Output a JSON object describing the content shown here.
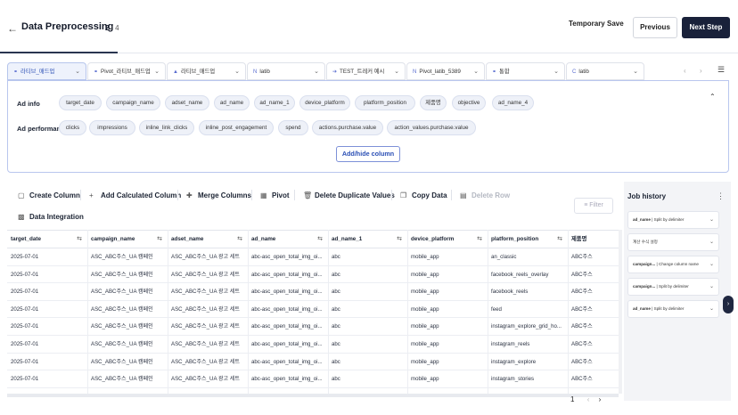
{
  "header": {
    "back_icon": "arrow-left-icon",
    "title": "Data Preprocessing",
    "step_current": "2",
    "step_total": " / 4",
    "progress_fraction": 0.4,
    "temporary_save": "Temporary Save",
    "previous": "Previous",
    "next": "Next Step"
  },
  "tabs": [
    {
      "icon": "link-icon",
      "label": "라티브_매드업",
      "active": true
    },
    {
      "icon": "link-icon",
      "label": "Pivot_라티브_매드업",
      "active": false
    },
    {
      "icon": "triangle-icon",
      "label": "라티브_매드업",
      "active": false
    },
    {
      "icon": "n-icon",
      "label": "latib",
      "active": false
    },
    {
      "icon": "arrow-icon",
      "label": "TEST_트레커 예시",
      "active": false
    },
    {
      "icon": "n-icon",
      "label": "Pivot_latib_5389",
      "active": false
    },
    {
      "icon": "link-icon",
      "label": "통합",
      "active": false
    },
    {
      "icon": "c-icon",
      "label": "latib",
      "active": false
    }
  ],
  "panel": {
    "ad_info_label": "Ad info",
    "ad_info_chips": [
      "target_date",
      "campaign_name",
      "adset_name",
      "ad_name",
      "ad_name_1",
      "device_platform",
      "platform_position",
      "제품명",
      "objective",
      "ad_name_4"
    ],
    "ad_perf_label": "Ad performance",
    "ad_perf_chips": [
      "clicks",
      "impressions",
      "inline_link_clicks",
      "inline_post_engagement",
      "spend",
      "actions.purchase.value",
      "action_values.purchase.value"
    ],
    "add_hide": "Add/hide column"
  },
  "toolbar": {
    "create_column": "Create Column",
    "add_calculated_column": "Add Calculated Column",
    "merge_columns": "Merge Columns",
    "pivot": "Pivot",
    "delete_duplicate": "Delete Duplicate Values",
    "copy_data": "Copy Data",
    "delete_row": "Delete Row",
    "data_integration": "Data Integration",
    "filter": "Filter"
  },
  "table": {
    "columns": [
      "target_date",
      "campaign_name",
      "adset_name",
      "ad_name",
      "ad_name_1",
      "device_platform",
      "platform_position",
      "제품명"
    ],
    "rows": [
      [
        "2025-07-01",
        "ASC_ABC주스_UA 캠페인",
        "ASC_ABC주스_UA 광고 세트",
        "abc-asc_open_total_img_oi...",
        "abc",
        "mobile_app",
        "an_classic",
        "ABC주스"
      ],
      [
        "2025-07-01",
        "ASC_ABC주스_UA 캠페인",
        "ASC_ABC주스_UA 광고 세트",
        "abc-asc_open_total_img_oi...",
        "abc",
        "mobile_app",
        "facebook_reels_overlay",
        "ABC주스"
      ],
      [
        "2025-07-01",
        "ASC_ABC주스_UA 캠페인",
        "ASC_ABC주스_UA 광고 세트",
        "abc-asc_open_total_img_oi...",
        "abc",
        "mobile_app",
        "facebook_reels",
        "ABC주스"
      ],
      [
        "2025-07-01",
        "ASC_ABC주스_UA 캠페인",
        "ASC_ABC주스_UA 광고 세트",
        "abc-asc_open_total_img_oi...",
        "abc",
        "mobile_app",
        "feed",
        "ABC주스"
      ],
      [
        "2025-07-01",
        "ASC_ABC주스_UA 캠페인",
        "ASC_ABC주스_UA 광고 세트",
        "abc-asc_open_total_img_oi...",
        "abc",
        "mobile_app",
        "instagram_explore_grid_ho...",
        "ABC주스"
      ],
      [
        "2025-07-01",
        "ASC_ABC주스_UA 캠페인",
        "ASC_ABC주스_UA 광고 세트",
        "abc-asc_open_total_img_oi...",
        "abc",
        "mobile_app",
        "instagram_reels",
        "ABC주스"
      ],
      [
        "2025-07-01",
        "ASC_ABC주스_UA 캠페인",
        "ASC_ABC주스_UA 광고 세트",
        "abc-asc_open_total_img_oi...",
        "abc",
        "mobile_app",
        "instagram_explore",
        "ABC주스"
      ],
      [
        "2025-07-01",
        "ASC_ABC주스_UA 캠페인",
        "ASC_ABC주스_UA 광고 세트",
        "abc-asc_open_total_img_oi...",
        "abc",
        "mobile_app",
        "instagram_stories",
        "ABC주스"
      ]
    ],
    "page": "1"
  },
  "job_history": {
    "title": "Job history",
    "items": [
      {
        "bold": "ad_name",
        "text": " | Split by delimiter"
      },
      {
        "bold": "",
        "text": "계산 수식 설정"
      },
      {
        "bold": "campaign...",
        "text": " | Change column name"
      },
      {
        "bold": "campaign...",
        "text": " | Split by delimiter"
      },
      {
        "bold": "ad_name",
        "text": " | Split by delimiter"
      }
    ]
  },
  "colors": {
    "accent": "#19213a",
    "chip_bg": "#eef1f8",
    "active_tab": "#2b4fb5"
  }
}
